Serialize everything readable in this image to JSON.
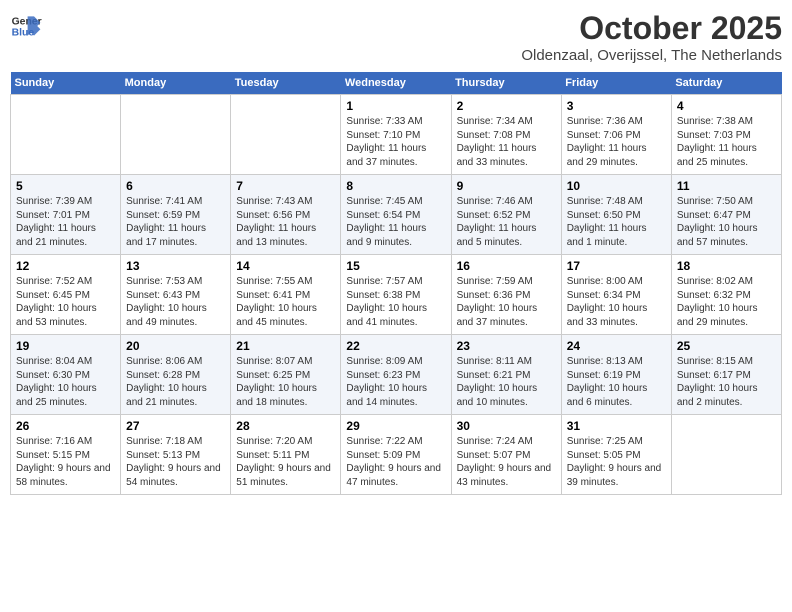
{
  "header": {
    "logo_line1": "General",
    "logo_line2": "Blue",
    "month": "October 2025",
    "location": "Oldenzaal, Overijssel, The Netherlands"
  },
  "weekdays": [
    "Sunday",
    "Monday",
    "Tuesday",
    "Wednesday",
    "Thursday",
    "Friday",
    "Saturday"
  ],
  "weeks": [
    [
      {
        "day": "",
        "info": ""
      },
      {
        "day": "",
        "info": ""
      },
      {
        "day": "",
        "info": ""
      },
      {
        "day": "1",
        "info": "Sunrise: 7:33 AM\nSunset: 7:10 PM\nDaylight: 11 hours and 37 minutes."
      },
      {
        "day": "2",
        "info": "Sunrise: 7:34 AM\nSunset: 7:08 PM\nDaylight: 11 hours and 33 minutes."
      },
      {
        "day": "3",
        "info": "Sunrise: 7:36 AM\nSunset: 7:06 PM\nDaylight: 11 hours and 29 minutes."
      },
      {
        "day": "4",
        "info": "Sunrise: 7:38 AM\nSunset: 7:03 PM\nDaylight: 11 hours and 25 minutes."
      }
    ],
    [
      {
        "day": "5",
        "info": "Sunrise: 7:39 AM\nSunset: 7:01 PM\nDaylight: 11 hours and 21 minutes."
      },
      {
        "day": "6",
        "info": "Sunrise: 7:41 AM\nSunset: 6:59 PM\nDaylight: 11 hours and 17 minutes."
      },
      {
        "day": "7",
        "info": "Sunrise: 7:43 AM\nSunset: 6:56 PM\nDaylight: 11 hours and 13 minutes."
      },
      {
        "day": "8",
        "info": "Sunrise: 7:45 AM\nSunset: 6:54 PM\nDaylight: 11 hours and 9 minutes."
      },
      {
        "day": "9",
        "info": "Sunrise: 7:46 AM\nSunset: 6:52 PM\nDaylight: 11 hours and 5 minutes."
      },
      {
        "day": "10",
        "info": "Sunrise: 7:48 AM\nSunset: 6:50 PM\nDaylight: 11 hours and 1 minute."
      },
      {
        "day": "11",
        "info": "Sunrise: 7:50 AM\nSunset: 6:47 PM\nDaylight: 10 hours and 57 minutes."
      }
    ],
    [
      {
        "day": "12",
        "info": "Sunrise: 7:52 AM\nSunset: 6:45 PM\nDaylight: 10 hours and 53 minutes."
      },
      {
        "day": "13",
        "info": "Sunrise: 7:53 AM\nSunset: 6:43 PM\nDaylight: 10 hours and 49 minutes."
      },
      {
        "day": "14",
        "info": "Sunrise: 7:55 AM\nSunset: 6:41 PM\nDaylight: 10 hours and 45 minutes."
      },
      {
        "day": "15",
        "info": "Sunrise: 7:57 AM\nSunset: 6:38 PM\nDaylight: 10 hours and 41 minutes."
      },
      {
        "day": "16",
        "info": "Sunrise: 7:59 AM\nSunset: 6:36 PM\nDaylight: 10 hours and 37 minutes."
      },
      {
        "day": "17",
        "info": "Sunrise: 8:00 AM\nSunset: 6:34 PM\nDaylight: 10 hours and 33 minutes."
      },
      {
        "day": "18",
        "info": "Sunrise: 8:02 AM\nSunset: 6:32 PM\nDaylight: 10 hours and 29 minutes."
      }
    ],
    [
      {
        "day": "19",
        "info": "Sunrise: 8:04 AM\nSunset: 6:30 PM\nDaylight: 10 hours and 25 minutes."
      },
      {
        "day": "20",
        "info": "Sunrise: 8:06 AM\nSunset: 6:28 PM\nDaylight: 10 hours and 21 minutes."
      },
      {
        "day": "21",
        "info": "Sunrise: 8:07 AM\nSunset: 6:25 PM\nDaylight: 10 hours and 18 minutes."
      },
      {
        "day": "22",
        "info": "Sunrise: 8:09 AM\nSunset: 6:23 PM\nDaylight: 10 hours and 14 minutes."
      },
      {
        "day": "23",
        "info": "Sunrise: 8:11 AM\nSunset: 6:21 PM\nDaylight: 10 hours and 10 minutes."
      },
      {
        "day": "24",
        "info": "Sunrise: 8:13 AM\nSunset: 6:19 PM\nDaylight: 10 hours and 6 minutes."
      },
      {
        "day": "25",
        "info": "Sunrise: 8:15 AM\nSunset: 6:17 PM\nDaylight: 10 hours and 2 minutes."
      }
    ],
    [
      {
        "day": "26",
        "info": "Sunrise: 7:16 AM\nSunset: 5:15 PM\nDaylight: 9 hours and 58 minutes."
      },
      {
        "day": "27",
        "info": "Sunrise: 7:18 AM\nSunset: 5:13 PM\nDaylight: 9 hours and 54 minutes."
      },
      {
        "day": "28",
        "info": "Sunrise: 7:20 AM\nSunset: 5:11 PM\nDaylight: 9 hours and 51 minutes."
      },
      {
        "day": "29",
        "info": "Sunrise: 7:22 AM\nSunset: 5:09 PM\nDaylight: 9 hours and 47 minutes."
      },
      {
        "day": "30",
        "info": "Sunrise: 7:24 AM\nSunset: 5:07 PM\nDaylight: 9 hours and 43 minutes."
      },
      {
        "day": "31",
        "info": "Sunrise: 7:25 AM\nSunset: 5:05 PM\nDaylight: 9 hours and 39 minutes."
      },
      {
        "day": "",
        "info": ""
      }
    ]
  ]
}
